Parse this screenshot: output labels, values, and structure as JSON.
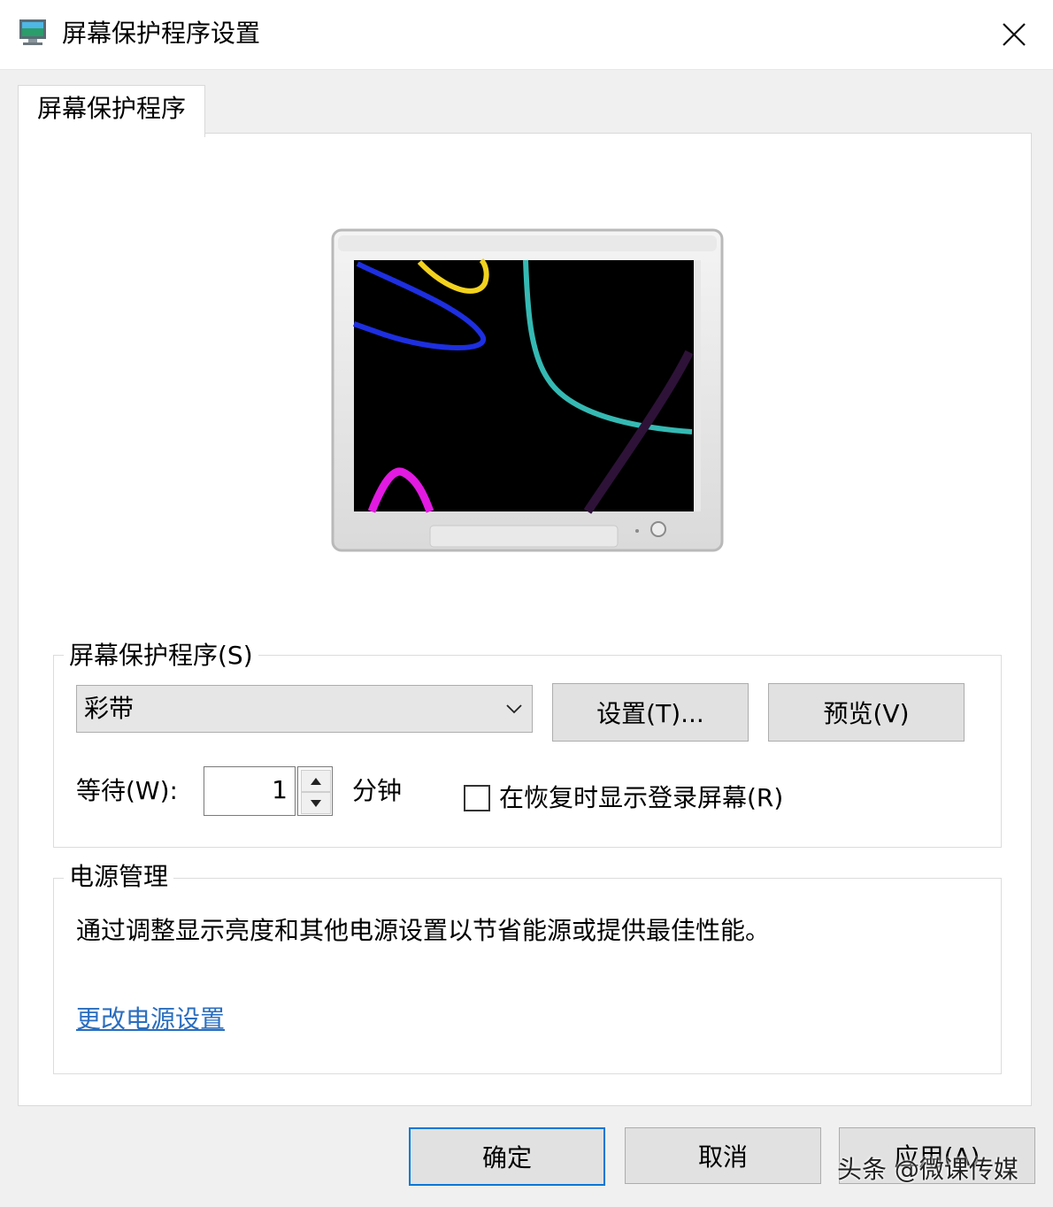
{
  "window": {
    "title": "屏幕保护程序设置"
  },
  "tab": {
    "label": "屏幕保护程序"
  },
  "screensaver_group": {
    "title": "屏幕保护程序(S)",
    "selected": "彩带",
    "settings_button": "设置(T)...",
    "preview_button": "预览(V)",
    "wait_label": "等待(W):",
    "wait_value": "1",
    "minutes_label": "分钟",
    "resume_checkbox_label": "在恢复时显示登录屏幕(R)",
    "resume_checked": false
  },
  "power_group": {
    "title": "电源管理",
    "description": "通过调整显示亮度和其他电源设置以节省能源或提供最佳性能。",
    "link": "更改电源设置"
  },
  "footer": {
    "ok_button": "确定",
    "cancel_button": "取消",
    "apply_button": "应用(A)"
  },
  "watermark": "头条 @微课传媒"
}
